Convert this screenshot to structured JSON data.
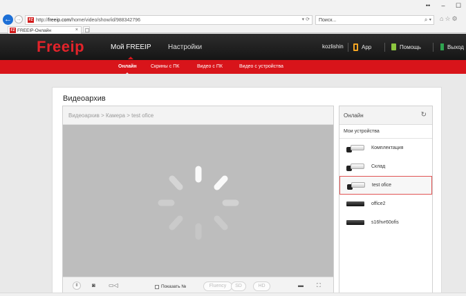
{
  "browser": {
    "url_prefix": "http://",
    "url_domain": "freeip.com",
    "url_path": "/home/video/show/id/988342796",
    "address_controls": "▾ ⟳",
    "search_placeholder": "Поиск...",
    "search_icon": "magnifier-icon",
    "tab_title": "FREEIP-Онлайн",
    "tab_close": "×",
    "favicon_text": "FZ"
  },
  "header": {
    "logo": "Freeip",
    "tabs": [
      {
        "label": "Мой FREEIP"
      },
      {
        "label": "Настройки"
      }
    ],
    "username": "kozlishin",
    "app_label": "App",
    "help_label": "Помощь",
    "exit_label": "Выход"
  },
  "subnav": [
    {
      "label": "Онлайн"
    },
    {
      "label": "Скрины с ПК"
    },
    {
      "label": "Видео с ПК"
    },
    {
      "label": "Видео с устройства"
    }
  ],
  "page": {
    "title": "Видеоархив",
    "breadcrumb": [
      "Видеоархив",
      ">",
      "Камера",
      ">",
      "test ofice"
    ]
  },
  "player_controls": {
    "show_nr_label": "Показать №",
    "fluency_label": "Fluency",
    "sd_label": "SD",
    "hd_label": "HD",
    "snapshot_icon": "camera-icon",
    "record_icon": "video-record-icon"
  },
  "sidebar": {
    "header": "Онлайн",
    "section": "Мои устройства",
    "devices": [
      {
        "name": "Комплектация",
        "kind": "camera"
      },
      {
        "name": "Склад",
        "kind": "camera"
      },
      {
        "name": "test ofice",
        "kind": "camera"
      },
      {
        "name": "office2",
        "kind": "dvr"
      },
      {
        "name": "s16hvr60ofis",
        "kind": "dvr"
      }
    ],
    "selected_device": "test ofice"
  },
  "colors": {
    "brand_red": "#d8141a",
    "header_dark": "#1c1c1c",
    "video_bg": "#bdbdbd",
    "selection_border": "#e05252"
  }
}
